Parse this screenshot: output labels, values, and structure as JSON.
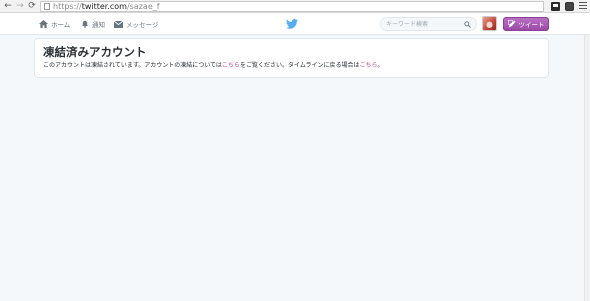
{
  "browser": {
    "url_scheme": "https://",
    "url_host": "twitter.com",
    "url_path": "/sazae_f",
    "nav": {
      "back": "←",
      "forward": "→",
      "reload": "⟳"
    }
  },
  "topbar": {
    "home_label": "ホーム",
    "notifications_label": "通知",
    "messages_label": "メッセージ",
    "search_placeholder": "キーワード検索",
    "tweet_label": "ツイート",
    "accent_color": "#9a4aa6"
  },
  "card": {
    "title": "凍結済みアカウント",
    "line_part1": "このアカウントは凍結されています。アカウントの凍結については",
    "link1": "こちら",
    "line_part2": "をご覧ください。タイムラインに戻る場合は",
    "link2": "こちら",
    "line_part3": "。",
    "link_color": "#c04a9a"
  },
  "icons": [
    "home-icon",
    "bell-icon",
    "envelope-icon",
    "twitter-bird-icon",
    "search-icon",
    "quill-icon",
    "page-icon",
    "menu-icon"
  ]
}
